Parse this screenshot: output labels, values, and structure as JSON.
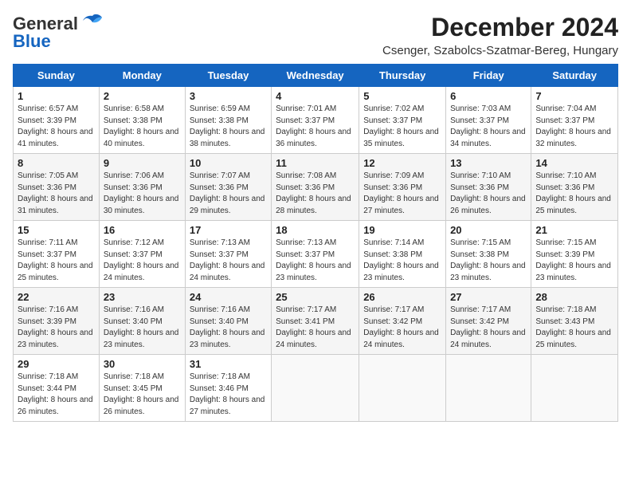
{
  "logo": {
    "line1": "General",
    "line2": "Blue"
  },
  "title": "December 2024",
  "location": "Csenger, Szabolcs-Szatmar-Bereg, Hungary",
  "weekdays": [
    "Sunday",
    "Monday",
    "Tuesday",
    "Wednesday",
    "Thursday",
    "Friday",
    "Saturday"
  ],
  "weeks": [
    [
      {
        "day": 1,
        "sunrise": "6:57 AM",
        "sunset": "3:39 PM",
        "daylight": "8 hours and 41 minutes."
      },
      {
        "day": 2,
        "sunrise": "6:58 AM",
        "sunset": "3:38 PM",
        "daylight": "8 hours and 40 minutes."
      },
      {
        "day": 3,
        "sunrise": "6:59 AM",
        "sunset": "3:38 PM",
        "daylight": "8 hours and 38 minutes."
      },
      {
        "day": 4,
        "sunrise": "7:01 AM",
        "sunset": "3:37 PM",
        "daylight": "8 hours and 36 minutes."
      },
      {
        "day": 5,
        "sunrise": "7:02 AM",
        "sunset": "3:37 PM",
        "daylight": "8 hours and 35 minutes."
      },
      {
        "day": 6,
        "sunrise": "7:03 AM",
        "sunset": "3:37 PM",
        "daylight": "8 hours and 34 minutes."
      },
      {
        "day": 7,
        "sunrise": "7:04 AM",
        "sunset": "3:37 PM",
        "daylight": "8 hours and 32 minutes."
      }
    ],
    [
      {
        "day": 8,
        "sunrise": "7:05 AM",
        "sunset": "3:36 PM",
        "daylight": "8 hours and 31 minutes."
      },
      {
        "day": 9,
        "sunrise": "7:06 AM",
        "sunset": "3:36 PM",
        "daylight": "8 hours and 30 minutes."
      },
      {
        "day": 10,
        "sunrise": "7:07 AM",
        "sunset": "3:36 PM",
        "daylight": "8 hours and 29 minutes."
      },
      {
        "day": 11,
        "sunrise": "7:08 AM",
        "sunset": "3:36 PM",
        "daylight": "8 hours and 28 minutes."
      },
      {
        "day": 12,
        "sunrise": "7:09 AM",
        "sunset": "3:36 PM",
        "daylight": "8 hours and 27 minutes."
      },
      {
        "day": 13,
        "sunrise": "7:10 AM",
        "sunset": "3:36 PM",
        "daylight": "8 hours and 26 minutes."
      },
      {
        "day": 14,
        "sunrise": "7:10 AM",
        "sunset": "3:36 PM",
        "daylight": "8 hours and 25 minutes."
      }
    ],
    [
      {
        "day": 15,
        "sunrise": "7:11 AM",
        "sunset": "3:37 PM",
        "daylight": "8 hours and 25 minutes."
      },
      {
        "day": 16,
        "sunrise": "7:12 AM",
        "sunset": "3:37 PM",
        "daylight": "8 hours and 24 minutes."
      },
      {
        "day": 17,
        "sunrise": "7:13 AM",
        "sunset": "3:37 PM",
        "daylight": "8 hours and 24 minutes."
      },
      {
        "day": 18,
        "sunrise": "7:13 AM",
        "sunset": "3:37 PM",
        "daylight": "8 hours and 23 minutes."
      },
      {
        "day": 19,
        "sunrise": "7:14 AM",
        "sunset": "3:38 PM",
        "daylight": "8 hours and 23 minutes."
      },
      {
        "day": 20,
        "sunrise": "7:15 AM",
        "sunset": "3:38 PM",
        "daylight": "8 hours and 23 minutes."
      },
      {
        "day": 21,
        "sunrise": "7:15 AM",
        "sunset": "3:39 PM",
        "daylight": "8 hours and 23 minutes."
      }
    ],
    [
      {
        "day": 22,
        "sunrise": "7:16 AM",
        "sunset": "3:39 PM",
        "daylight": "8 hours and 23 minutes."
      },
      {
        "day": 23,
        "sunrise": "7:16 AM",
        "sunset": "3:40 PM",
        "daylight": "8 hours and 23 minutes."
      },
      {
        "day": 24,
        "sunrise": "7:16 AM",
        "sunset": "3:40 PM",
        "daylight": "8 hours and 23 minutes."
      },
      {
        "day": 25,
        "sunrise": "7:17 AM",
        "sunset": "3:41 PM",
        "daylight": "8 hours and 24 minutes."
      },
      {
        "day": 26,
        "sunrise": "7:17 AM",
        "sunset": "3:42 PM",
        "daylight": "8 hours and 24 minutes."
      },
      {
        "day": 27,
        "sunrise": "7:17 AM",
        "sunset": "3:42 PM",
        "daylight": "8 hours and 24 minutes."
      },
      {
        "day": 28,
        "sunrise": "7:18 AM",
        "sunset": "3:43 PM",
        "daylight": "8 hours and 25 minutes."
      }
    ],
    [
      {
        "day": 29,
        "sunrise": "7:18 AM",
        "sunset": "3:44 PM",
        "daylight": "8 hours and 26 minutes."
      },
      {
        "day": 30,
        "sunrise": "7:18 AM",
        "sunset": "3:45 PM",
        "daylight": "8 hours and 26 minutes."
      },
      {
        "day": 31,
        "sunrise": "7:18 AM",
        "sunset": "3:46 PM",
        "daylight": "8 hours and 27 minutes."
      },
      null,
      null,
      null,
      null
    ]
  ]
}
